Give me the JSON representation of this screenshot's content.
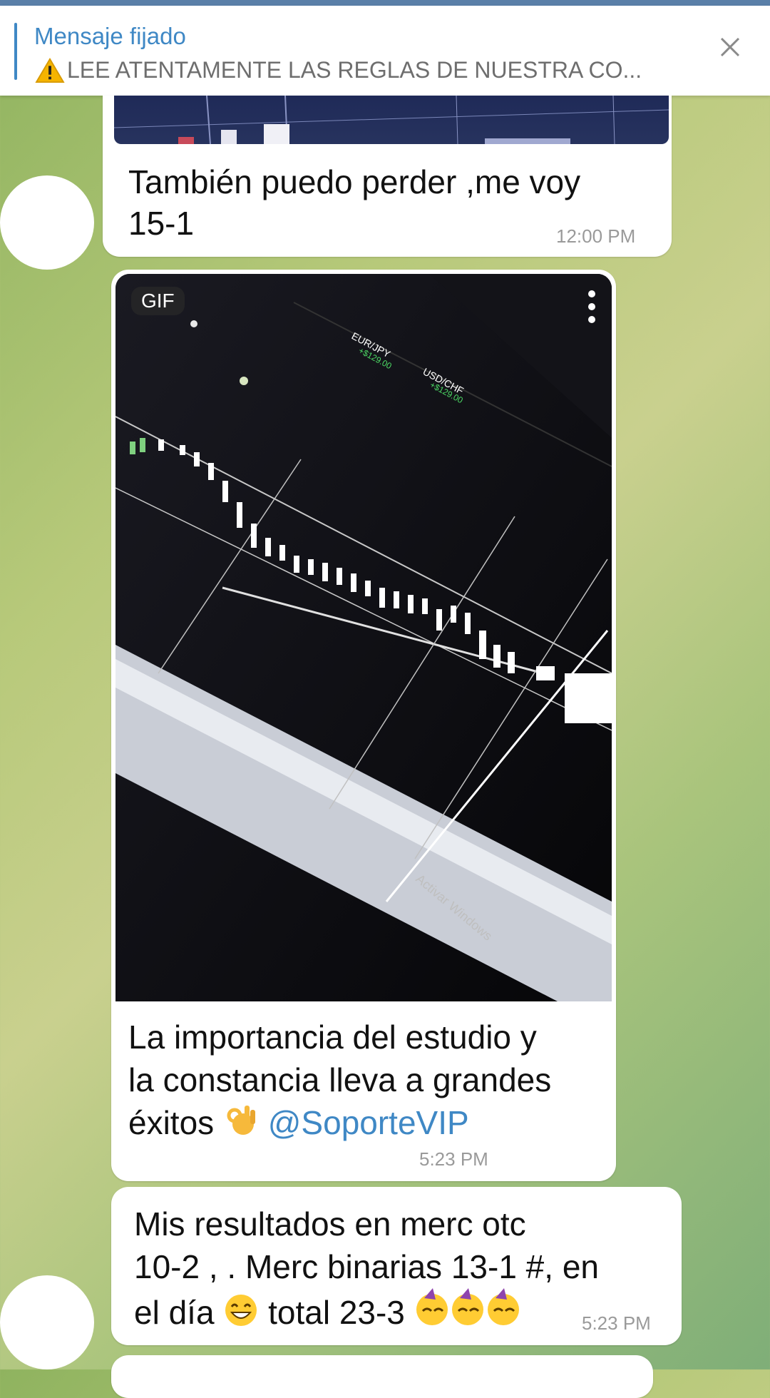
{
  "pinned": {
    "title": "Mensaje fijado",
    "text": "LEE ATENTAMENTE LAS REGLAS DE NUESTRA CO..."
  },
  "messages": [
    {
      "text_line1": "También puedo perder  ,me voy",
      "text_line2": "15-1",
      "time": "12:00 PM"
    },
    {
      "media_badge": "GIF",
      "text_line1": "La importancia del estudio y",
      "text_line2": "la constancia lleva a grandes",
      "text_line3": "éxitos",
      "mention": "@SoporteVIP",
      "time": "5:23 PM"
    },
    {
      "text_line1": "Mis resultados en merc otc",
      "text_line2": "10-2 , .  Merc binarias 13-1  #, en",
      "text_line3a": "el día",
      "text_line3b": "total 23-3",
      "time": "5:23 PM"
    }
  ],
  "icons": {
    "warning": "warning-icon",
    "close": "close-icon",
    "menu": "more-vert-icon",
    "ok_hand": "ok-hand-emoji",
    "grin": "grin-emoji",
    "party": "party-face-emoji"
  },
  "colors": {
    "accent": "#3f88c5",
    "bubble": "#ffffff",
    "timestamp": "#9a9a9a"
  }
}
